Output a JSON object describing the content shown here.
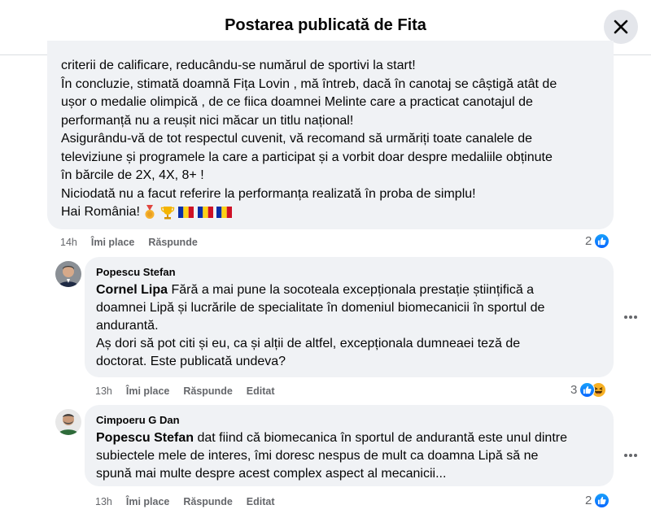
{
  "header": {
    "title": "Postarea publicată de Fita"
  },
  "comment1": {
    "lines": [
      "criterii de calificare, reducându-se numărul de sportivi la start!",
      "În concluzie, stimată doamnă Fița Lovin , mă întreb, dacă în canotaj se câștigă atât de",
      "ușor o medalie olimpică , de ce fiica doamnei Melinte care a practicat canotajul de",
      "performanță nu a reușit nici măcar un titlu național!",
      "Asigurându-vă de tot respectul cuvenit, vă recomand să urmăriți toate canalele de",
      "televiziune și programele la care a participat și a vorbit doar despre medaliile obținute",
      "în bărcile de 2X, 4X, 8+ !",
      "Niciodată nu a facut referire la performanța realizată în proba de simplu!",
      "Hai România!"
    ],
    "time": "14h",
    "like_label": "Îmi place",
    "reply_label": "Răspunde",
    "reaction_count": "2",
    "reaction_icons": [
      "like-icon"
    ]
  },
  "comment2": {
    "author": "Popescu Stefan",
    "mention": "Cornel Lipa",
    "lines": [
      "Fără a mai pune la socoteala excepționala prestație științifică a",
      "doamnei Lipă și lucrările de specialitate în domeniul biomecanicii în sportul de",
      "andurantă.",
      "Aș dori să pot citi și eu, ca și alții de altfel, excepționala dumneaei teză de",
      "doctorat. Este publicată undeva?"
    ],
    "time": "13h",
    "like_label": "Îmi place",
    "reply_label": "Răspunde",
    "edited_label": "Editat",
    "reaction_count": "3",
    "reaction_icons": [
      "like-icon",
      "haha-icon"
    ]
  },
  "comment3": {
    "author": "Cimpoeru G Dan",
    "mention": "Popescu Stefan",
    "lines": [
      "dat fiind că biomecanica în sportul de andurantă este unul dintre",
      "subiectele mele de interes, îmi doresc nespus de mult ca doamna Lipă să ne",
      "spună mai multe despre acest complex aspect al mecanicii..."
    ],
    "time": "13h",
    "like_label": "Îmi place",
    "reply_label": "Răspunde",
    "edited_label": "Editat",
    "reaction_count": "2",
    "reaction_icons": [
      "like-icon"
    ]
  },
  "colors": {
    "accent": "#0866ff",
    "bubble": "#f0f2f5",
    "meta": "#65676b"
  }
}
